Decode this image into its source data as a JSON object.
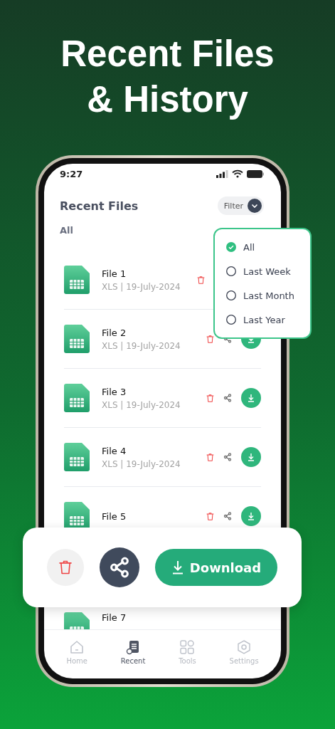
{
  "headline": [
    "Recent Files",
    "& History"
  ],
  "status_bar": {
    "time": "9:27"
  },
  "header": {
    "title": "Recent Files",
    "filter": "Filter"
  },
  "section": "All",
  "files": [
    {
      "name": "File 1",
      "meta": "XLS | 19-July-2024"
    },
    {
      "name": "File 2",
      "meta": "XLS | 19-July-2024"
    },
    {
      "name": "File 3",
      "meta": "XLS | 19-July-2024"
    },
    {
      "name": "File 4",
      "meta": "XLS | 19-July-2024"
    },
    {
      "name": "File 5"
    },
    {
      "name": "File 7"
    }
  ],
  "filter_menu": [
    {
      "label": "All",
      "selected": true
    },
    {
      "label": "Last Week",
      "selected": false
    },
    {
      "label": "Last Month",
      "selected": false
    },
    {
      "label": "Last Year",
      "selected": false
    }
  ],
  "action_bar": {
    "download": "Download"
  },
  "nav": [
    {
      "label": "Home",
      "kind": "home",
      "selected": false
    },
    {
      "label": "Recent",
      "kind": "recent",
      "selected": true
    },
    {
      "label": "Tools",
      "kind": "tools",
      "selected": false
    },
    {
      "label": "Settings",
      "kind": "settings",
      "selected": false
    }
  ]
}
